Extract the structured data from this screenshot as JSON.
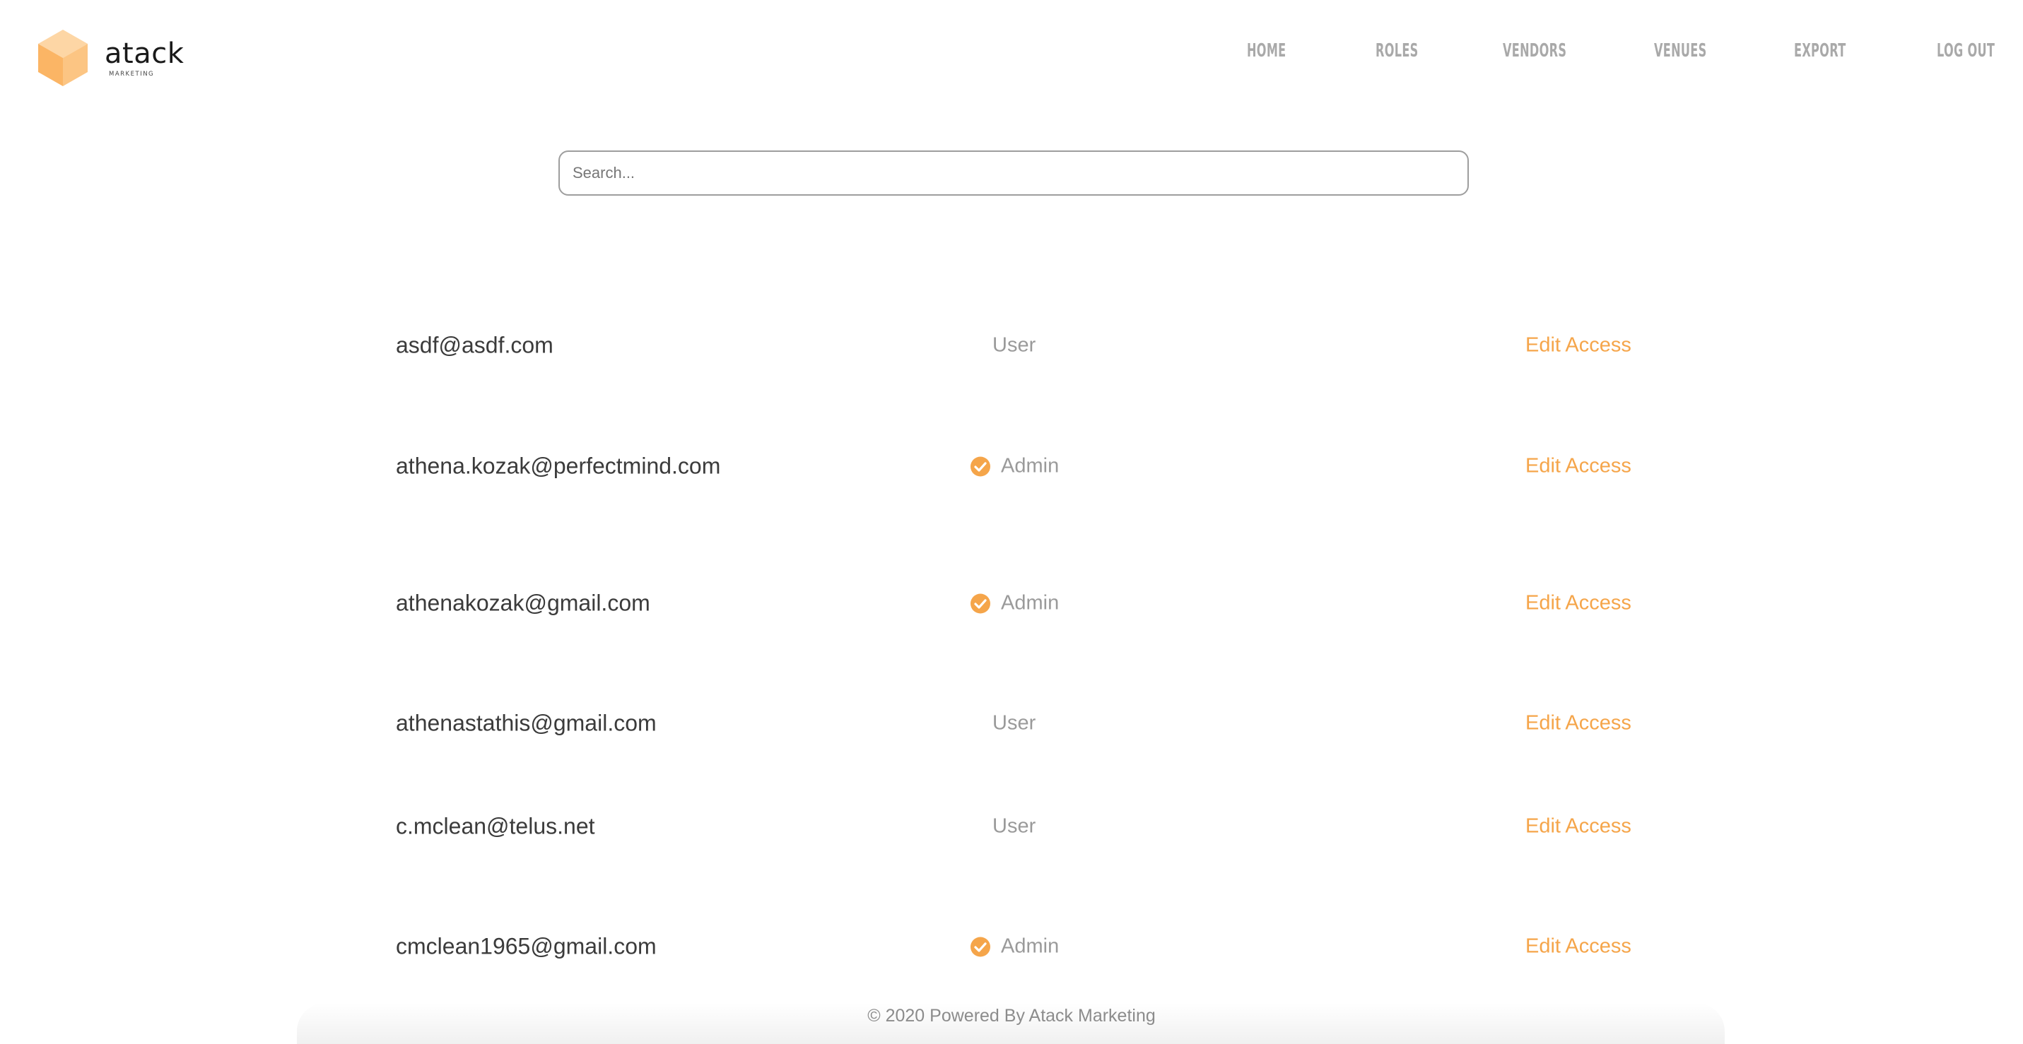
{
  "brand": {
    "name": "atack",
    "subtitle": "MARKETING",
    "accent_color": "#f5a54a",
    "logo_icon": "cube-icon"
  },
  "nav": {
    "items": [
      {
        "label": "HOME"
      },
      {
        "label": "ROLES"
      },
      {
        "label": "VENDORS"
      },
      {
        "label": "VENUES"
      },
      {
        "label": "EXPORT"
      },
      {
        "label": "LOG OUT"
      }
    ]
  },
  "search": {
    "placeholder": "Search...",
    "value": ""
  },
  "users": [
    {
      "email": "asdf@asdf.com",
      "role": "User",
      "is_admin": false,
      "action": "Edit Access"
    },
    {
      "email": "athena.kozak@perfectmind.com",
      "role": "Admin",
      "is_admin": true,
      "action": "Edit Access"
    },
    {
      "email": "athenakozak@gmail.com",
      "role": "Admin",
      "is_admin": true,
      "action": "Edit Access"
    },
    {
      "email": "athenastathis@gmail.com",
      "role": "User",
      "is_admin": false,
      "action": "Edit Access"
    },
    {
      "email": "c.mclean@telus.net",
      "role": "User",
      "is_admin": false,
      "action": "Edit Access"
    },
    {
      "email": "cmclean1965@gmail.com",
      "role": "Admin",
      "is_admin": true,
      "action": "Edit Access"
    }
  ],
  "footer": {
    "text": "© 2020 Powered By Atack Marketing"
  }
}
